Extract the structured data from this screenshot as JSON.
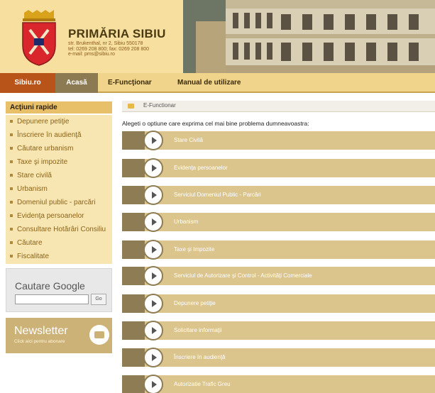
{
  "header": {
    "title": "PRIMĂRIA SIBIU",
    "address": "str. Brukenthal, nr 2, Sibiu 550178",
    "phone": "tel: 0269 208 800; fax: 0269 208 800",
    "email": "e-mail: pms@sibiu.ro"
  },
  "nav": {
    "items": [
      "Sibiu.ro",
      "Acasă",
      "E-Funcţionar",
      "Manual de utilizare"
    ]
  },
  "sidebar": {
    "title": "Acţiuni rapide",
    "items": [
      "Depunere petiţie",
      "Înscriere în audienţă",
      "Căutare urbanism",
      "Taxe şi impozite",
      "Stare civilă",
      "Urbanism",
      "Domeniul public - parcări",
      "Evidenţa persoanelor",
      "Consultare Hotărâri Consiliu",
      "Căutare",
      "Fiscalitate"
    ]
  },
  "google": {
    "title": "Cautare Google",
    "go_label": "Go"
  },
  "newsletter": {
    "title": "Newsletter",
    "subtitle": "Click aici pentru abonare"
  },
  "main": {
    "breadcrumb": "E-Functionar",
    "intro": "Alegeti o optiune care exprima cel mai bine problema dumneavoastra:",
    "options": [
      "Stare Civilă",
      "Evidenţa persoanelor",
      "Serviciul Domeniul Public - Parcări",
      "Urbanism",
      "Taxe şi Impozite",
      "Serviciul de Autorizare şi Control - Activităţi Comerciale",
      "Depunere petiţie",
      "Solicitare informaţii",
      "Înscriere în audienţă",
      "Autorizatie Trafic Greu"
    ]
  },
  "colors": {
    "header_bg": "#f7dfa0",
    "nav_active": "#b8541a",
    "nav_dark": "#8c7b52",
    "option_bg": "#dbc58c"
  }
}
